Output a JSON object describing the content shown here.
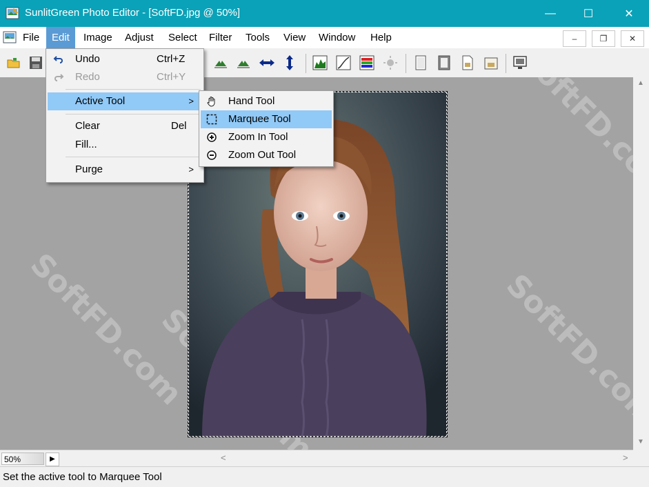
{
  "window": {
    "title": "SunlitGreen Photo Editor - [SoftFD.jpg @ 50%]",
    "minimize": "—",
    "maximize": "☐",
    "close": "✕"
  },
  "menubar": {
    "items": [
      "File",
      "Edit",
      "Image",
      "Adjust",
      "Select",
      "Filter",
      "Tools",
      "View",
      "Window",
      "Help"
    ],
    "active": "Edit"
  },
  "mdi": {
    "minimize": "–",
    "restore": "❐",
    "close": "✕"
  },
  "edit_menu": {
    "undo": {
      "label": "Undo",
      "shortcut": "Ctrl+Z"
    },
    "redo": {
      "label": "Redo",
      "shortcut": "Ctrl+Y"
    },
    "active_tool": {
      "label": "Active Tool"
    },
    "clear": {
      "label": "Clear",
      "shortcut": "Del"
    },
    "fill": {
      "label": "Fill..."
    },
    "purge": {
      "label": "Purge"
    }
  },
  "tool_submenu": {
    "items": [
      "Hand Tool",
      "Marquee Tool",
      "Zoom In Tool",
      "Zoom Out Tool"
    ],
    "highlighted": "Marquee Tool"
  },
  "zoom": {
    "value": "50%",
    "arrow": "▶"
  },
  "scroll": {
    "up": "▲",
    "down": "▼",
    "left": "<",
    "right": ">"
  },
  "status": {
    "text": "Set the active tool to Marquee Tool"
  },
  "watermark": "SoftFD.com",
  "colors": {
    "titlebar": "#0aa2b8",
    "menu_active": "#5b9bd5",
    "menu_highlight": "#91c9f7",
    "canvas": "#a3a3a3"
  }
}
